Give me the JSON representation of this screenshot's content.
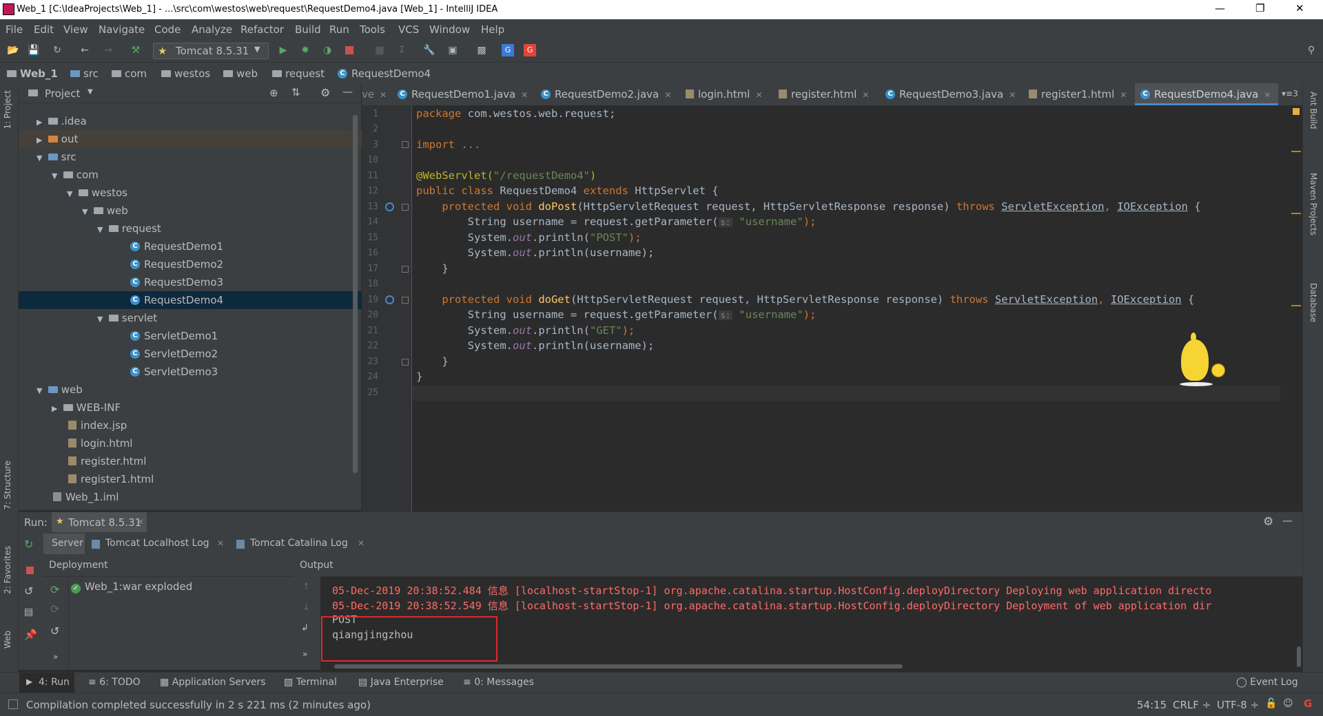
{
  "window": {
    "title": "Web_1 [C:\\IdeaProjects\\Web_1] - ...\\src\\com\\westos\\web\\request\\RequestDemo4.java [Web_1] - IntelliJ IDEA"
  },
  "menu": [
    "File",
    "Edit",
    "View",
    "Navigate",
    "Code",
    "Analyze",
    "Refactor",
    "Build",
    "Run",
    "Tools",
    "VCS",
    "Window",
    "Help"
  ],
  "toolbar": {
    "run_config": "Tomcat 8.5.31"
  },
  "breadcrumb": [
    "Web_1",
    "src",
    "com",
    "westos",
    "web",
    "request",
    "RequestDemo4"
  ],
  "left_strip": {
    "project": "1: Project",
    "structure": "7: Structure",
    "favorites": "2: Favorites",
    "web": "Web"
  },
  "right_strip": {
    "ant": "Ant Build",
    "maven": "Maven Projects",
    "database": "Database"
  },
  "project_panel": {
    "title": "Project",
    "tree": [
      {
        "label": ".idea",
        "type": "folder"
      },
      {
        "label": "out",
        "type": "folder-orange"
      },
      {
        "label": "src",
        "type": "folder-blue"
      },
      {
        "label": "com",
        "type": "package"
      },
      {
        "label": "westos",
        "type": "package"
      },
      {
        "label": "web",
        "type": "package"
      },
      {
        "label": "request",
        "type": "package"
      },
      {
        "label": "RequestDemo1",
        "type": "class"
      },
      {
        "label": "RequestDemo2",
        "type": "class"
      },
      {
        "label": "RequestDemo3",
        "type": "class"
      },
      {
        "label": "RequestDemo4",
        "type": "class"
      },
      {
        "label": "servlet",
        "type": "package"
      },
      {
        "label": "ServletDemo1",
        "type": "class"
      },
      {
        "label": "ServletDemo2",
        "type": "class"
      },
      {
        "label": "ServletDemo3",
        "type": "class"
      },
      {
        "label": "web",
        "type": "folder-blue"
      },
      {
        "label": "WEB-INF",
        "type": "folder"
      },
      {
        "label": "index.jsp",
        "type": "html"
      },
      {
        "label": "login.html",
        "type": "html"
      },
      {
        "label": "register.html",
        "type": "html"
      },
      {
        "label": "register1.html",
        "type": "html"
      },
      {
        "label": "Web_1.iml",
        "type": "file"
      }
    ]
  },
  "editor_tabs": [
    "ve",
    "RequestDemo1.java",
    "RequestDemo2.java",
    "login.html",
    "register.html",
    "RequestDemo3.java",
    "register1.html",
    "RequestDemo4.java"
  ],
  "editor_tabs_more": "3",
  "code": {
    "line_numbers": [
      "1",
      "2",
      "3",
      "10",
      "11",
      "12",
      "13",
      "14",
      "15",
      "16",
      "17",
      "18",
      "19",
      "20",
      "21",
      "22",
      "23",
      "24",
      "25"
    ],
    "l1_kw": "package",
    "l1_rest": " com.westos.web.request;",
    "l3_kw": "import",
    "l3_rest": " ...",
    "l10_ann": "@WebServlet(",
    "l10_str": "\"/requestDemo4\"",
    "l10_end": ")",
    "l11_kw": "public class",
    "l11_name": " RequestDemo4 ",
    "l11_kw2": "extends",
    "l11_rest": " HttpServlet {",
    "l12_kw": "    protected void ",
    "l12_fn": "doPost",
    "l12_mid": "(HttpServletRequest request, HttpServletResponse response) ",
    "l12_throws": "throws",
    "l12_ex1": "ServletException",
    "l12_comma": ", ",
    "l12_ex2": "IOException",
    "l12_end": " {",
    "l13_a": "        String username = request.getParameter(",
    "l13_hint": "s:",
    "l13_str": "\"username\"",
    "l13_end": ");",
    "l14_a": "        System.",
    "l14_out": "out",
    "l14_b": ".println(",
    "l14_str": "\"POST\"",
    "l14_end": ");",
    "l15_a": "        System.",
    "l15_out": "out",
    "l15_b": ".println(username);",
    "l16": "    }",
    "l18_kw": "    protected void ",
    "l18_fn": "doGet",
    "l18_mid": "(HttpServletRequest request, HttpServletResponse response) ",
    "l18_throws": "throws",
    "l18_ex1": "ServletException",
    "l18_comma": ", ",
    "l18_ex2": "IOException",
    "l18_end": " {",
    "l19_a": "        String username = request.getParameter(",
    "l19_hint": "s:",
    "l19_str": "\"username\"",
    "l19_end": ");",
    "l20_a": "        System.",
    "l20_out": "out",
    "l20_b": ".println(",
    "l20_str": "\"GET\"",
    "l20_end": ");",
    "l21_a": "        System.",
    "l21_out": "out",
    "l21_b": ".println(username);",
    "l22": "    }",
    "l23": "}"
  },
  "run_panel": {
    "label": "Run:",
    "config_tab": "Tomcat 8.5.31",
    "tabs": [
      "Server",
      "Tomcat Localhost Log",
      "Tomcat Catalina Log"
    ],
    "deployment_header": "Deployment",
    "output_header": "Output",
    "deployment_item": "Web_1:war exploded",
    "log_lines": [
      "05-Dec-2019 20:38:52.484 信息 [localhost-startStop-1] org.apache.catalina.startup.HostConfig.deployDirectory Deploying web application directo",
      "05-Dec-2019 20:38:52.549 信息 [localhost-startStop-1] org.apache.catalina.startup.HostConfig.deployDirectory Deployment of web application dir"
    ],
    "output_lines": [
      "POST",
      "qiangjingzhou"
    ],
    "highlight_color": "#e0282e"
  },
  "bottom_tabs": [
    "4: Run",
    "6: TODO",
    "Application Servers",
    "Terminal",
    "Java Enterprise",
    "0: Messages"
  ],
  "event_log": "Event Log",
  "status": {
    "message": "Compilation completed successfully in 2 s 221 ms (2 minutes ago)",
    "position": "54:15",
    "line_sep": "CRLF",
    "encoding": "UTF-8"
  }
}
